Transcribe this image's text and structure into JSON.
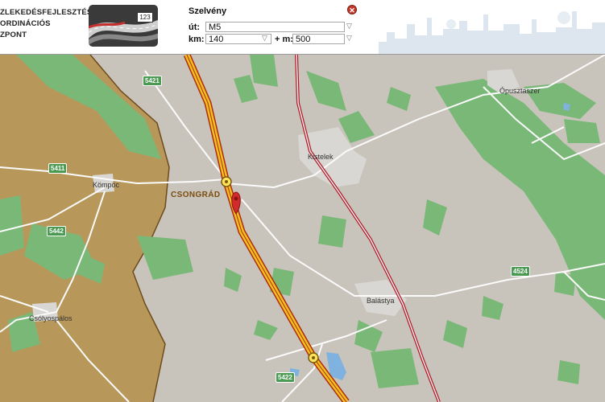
{
  "header": {
    "org_lines": [
      "ZLEKEDÉSFEJLESZTÉSI",
      "ORDINÁCIÓS",
      "ZPONT"
    ],
    "logo_badge": "123",
    "title": "Szelvény",
    "ut_label": "út:",
    "ut_value": "M5",
    "km_label": "km:",
    "km_value": "140",
    "m_label": "+ m:",
    "m_value": "500",
    "close_icon": "close-icon"
  },
  "map": {
    "county_label": "CSONGRÁD",
    "places": {
      "kistelek": "Kistelek",
      "kompoc": "Kömpöc",
      "pusztaszer": "Ópusztaszer",
      "balastya": "Balástya",
      "csolyospalos": "Csólyospálos"
    },
    "road_shields": {
      "r5421": "5421",
      "r5411": "5411",
      "r5442": "5442",
      "r4524": "4524",
      "r5422": "5422"
    },
    "marker_icon": "map-pin-icon",
    "colors": {
      "motorway": "#d9a11a",
      "railway": "#b01c2a",
      "forest": "#7ab878",
      "county": "#b8985a"
    }
  }
}
